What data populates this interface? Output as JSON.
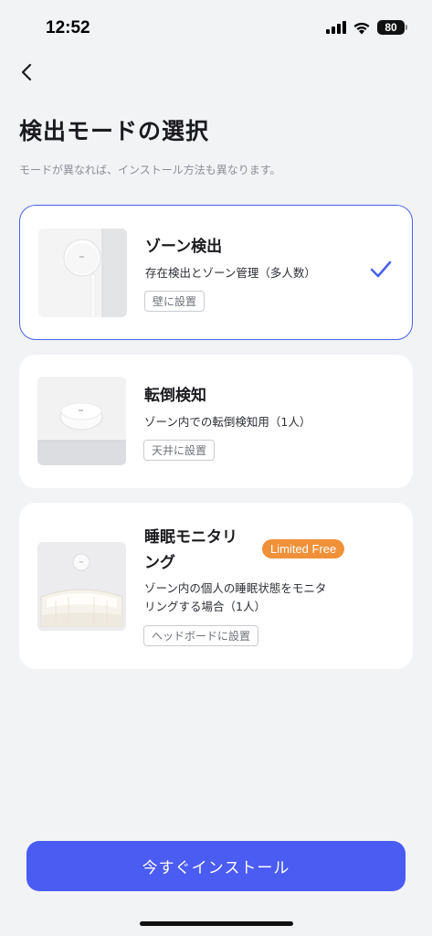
{
  "status_bar": {
    "time": "12:52",
    "battery": "80"
  },
  "header": {
    "title": "検出モードの選択",
    "subtitle": "モードが異なれば、インストール方法も異なります。"
  },
  "modes": [
    {
      "title": "ゾーン検出",
      "description": "存在検出とゾーン管理（多人数）",
      "tag": "壁に設置",
      "selected": true
    },
    {
      "title": "転倒検知",
      "description": "ゾーン内での転倒検知用（1人）",
      "tag": "天井に設置",
      "selected": false
    },
    {
      "title_line1": "睡眠モニタリ",
      "title_line2": "ング",
      "badge": "Limited Free",
      "description_line1": "ゾーン内の個人の睡眠状態をモニタ",
      "description_line2": "リングする場合（1人）",
      "tag": "ヘッドボードに設置",
      "selected": false
    }
  ],
  "footer": {
    "install_label": "今すぐインストール"
  },
  "colors": {
    "accent": "#4a5cf2",
    "selected_border": "#4a62e8",
    "badge": "#f0913a"
  }
}
